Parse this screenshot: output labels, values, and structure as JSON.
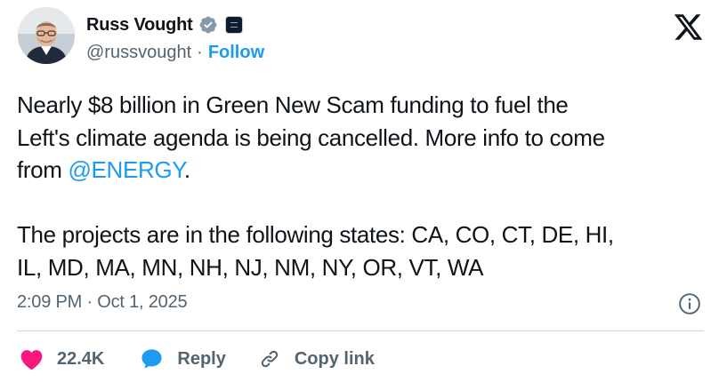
{
  "author": {
    "name": "Russ Vought",
    "handle": "@russvought",
    "separator": "·",
    "follow_label": "Follow"
  },
  "tweet": {
    "line1": "Nearly $8 billion in Green New Scam funding to fuel the",
    "line2": "Left's climate agenda is being cancelled. More info to come",
    "line3_prefix": "from ",
    "mention": "@ENERGY",
    "line3_suffix": ".",
    "line4": "The projects are in the following states: CA, CO, CT, DE, HI,",
    "line5": "IL, MD, MA, MN, NH, NJ, NM, NY, OR, VT, WA"
  },
  "timestamp": "2:09 PM · Oct 1, 2025",
  "actions": {
    "like_count": "22.4K",
    "reply_label": "Reply",
    "copy_link_label": "Copy link"
  },
  "icons": {
    "verified": "verified-badge-icon",
    "affiliation": "affiliate-badge-icon",
    "brand": "x-logo-icon",
    "info": "info-icon",
    "like": "heart-icon",
    "reply": "speech-bubble-icon",
    "link": "link-icon"
  },
  "colors": {
    "accent": "#1d9bf0",
    "like": "#f91880",
    "text_primary": "#0f1419",
    "text_secondary": "#536471",
    "verified_badge": "#829aab"
  }
}
